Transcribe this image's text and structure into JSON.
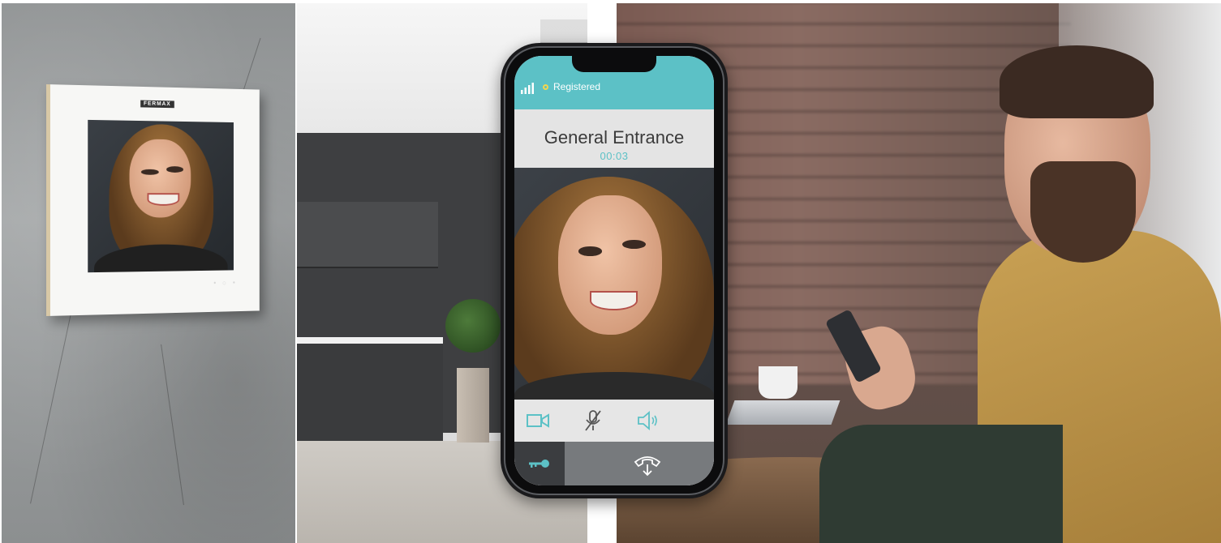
{
  "monitor": {
    "brand": "FERMAX",
    "buttons": "• ○ •"
  },
  "phone": {
    "status": {
      "signal_icon": "signal-bars-icon",
      "registered_label": "Registered",
      "registered_dot_color": "#f4d64e",
      "bar_color": "#5cc1c6"
    },
    "call": {
      "caller": "General Entrance",
      "timer": "00:03"
    },
    "controls": {
      "video_icon": "video-camera-icon",
      "mute_icon": "microphone-muted-icon",
      "speaker_icon": "speaker-icon",
      "accent": "#5cc1c6"
    },
    "bottom": {
      "door_icon": "key-icon",
      "hangup_icon": "hangup-icon"
    }
  }
}
